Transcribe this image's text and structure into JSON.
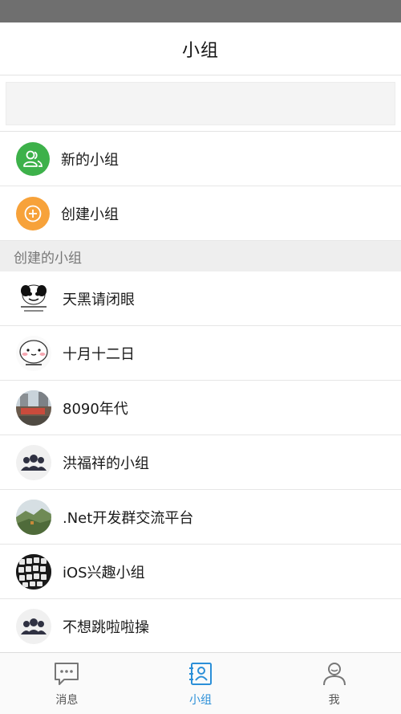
{
  "header": {
    "title": "小组"
  },
  "menu": {
    "new_group": "新的小组",
    "create_group": "创建小组"
  },
  "section": {
    "title": "创建的小组"
  },
  "groups": [
    {
      "name": "天黑请闭眼",
      "avatar": "panda-meme-avatar"
    },
    {
      "name": "十月十二日",
      "avatar": "blob-meme-avatar"
    },
    {
      "name": "8090年代",
      "avatar": "street-photo-avatar"
    },
    {
      "name": "洪福祥的小组",
      "avatar": "group-default-avatar"
    },
    {
      "name": ".Net开发群交流平台",
      "avatar": "landscape-photo-avatar"
    },
    {
      "name": "iOS兴趣小组",
      "avatar": "keyboard-photo-avatar"
    },
    {
      "name": "不想跳啦啦操",
      "avatar": "group-default-avatar"
    }
  ],
  "tabbar": {
    "tabs": [
      {
        "label": "消息",
        "icon": "message-icon"
      },
      {
        "label": "小组",
        "icon": "contacts-icon"
      },
      {
        "label": "我",
        "icon": "profile-icon"
      }
    ],
    "active_index": 1
  },
  "colors": {
    "accent": "#2b8fd8",
    "green": "#3db14a",
    "orange": "#f7a23a"
  }
}
